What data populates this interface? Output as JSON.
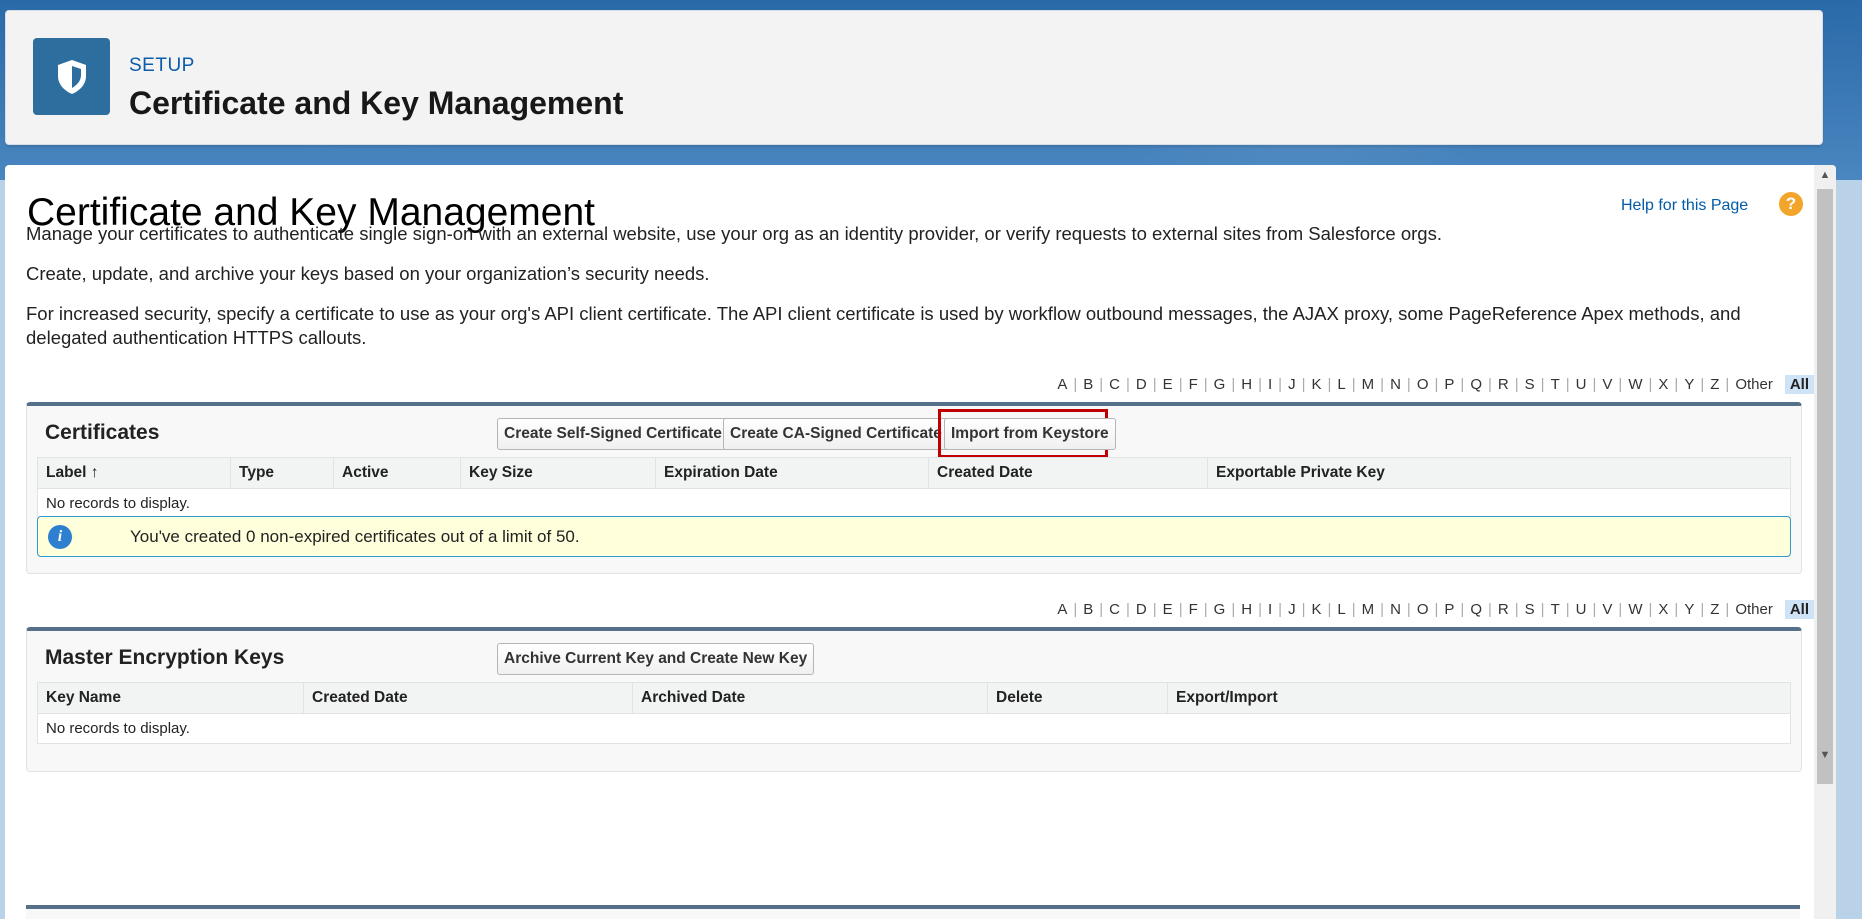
{
  "header": {
    "setup_label": "SETUP",
    "title": "Certificate and Key Management",
    "icon": "shield-icon"
  },
  "page": {
    "title": "Certificate and Key Management",
    "help_link": "Help for this Page",
    "help_icon": "question-icon",
    "desc1": "Manage your certificates to authenticate single sign-on with an external website, use your org as an identity provider, or verify requests to external sites from Salesforce orgs.",
    "desc2": "Create, update, and archive your keys based on your organization’s security needs.",
    "desc3": "For increased security, specify a certificate to use as your org's API client certificate. The API client certificate is used by workflow outbound messages, the AJAX proxy, some PageReference Apex methods, and delegated authentication HTTPS callouts."
  },
  "alpha": {
    "letters": [
      "A",
      "B",
      "C",
      "D",
      "E",
      "F",
      "G",
      "H",
      "I",
      "J",
      "K",
      "L",
      "M",
      "N",
      "O",
      "P",
      "Q",
      "R",
      "S",
      "T",
      "U",
      "V",
      "W",
      "X",
      "Y",
      "Z",
      "Other"
    ],
    "all": "All"
  },
  "certificates": {
    "title": "Certificates",
    "btn_self_signed": "Create Self-Signed Certificate",
    "btn_ca_signed": "Create CA-Signed Certificate",
    "btn_import": "Import from Keystore",
    "columns": [
      "Label",
      "Type",
      "Active",
      "Key Size",
      "Expiration Date",
      "Created Date",
      "Exportable Private Key"
    ],
    "sort_arrow": "↑",
    "empty": "No records to display.",
    "info": "You've created 0 non-expired certificates out of a limit of 50."
  },
  "master_keys": {
    "title": "Master Encryption Keys",
    "btn_archive": "Archive Current Key and Create New Key",
    "columns": [
      "Key Name",
      "Created Date",
      "Archived Date",
      "Delete",
      "Export/Import"
    ],
    "empty": "No records to display."
  },
  "colors": {
    "brand": "#2e6e9e",
    "highlight": "#c00000",
    "info_bg": "#ffffdc"
  }
}
